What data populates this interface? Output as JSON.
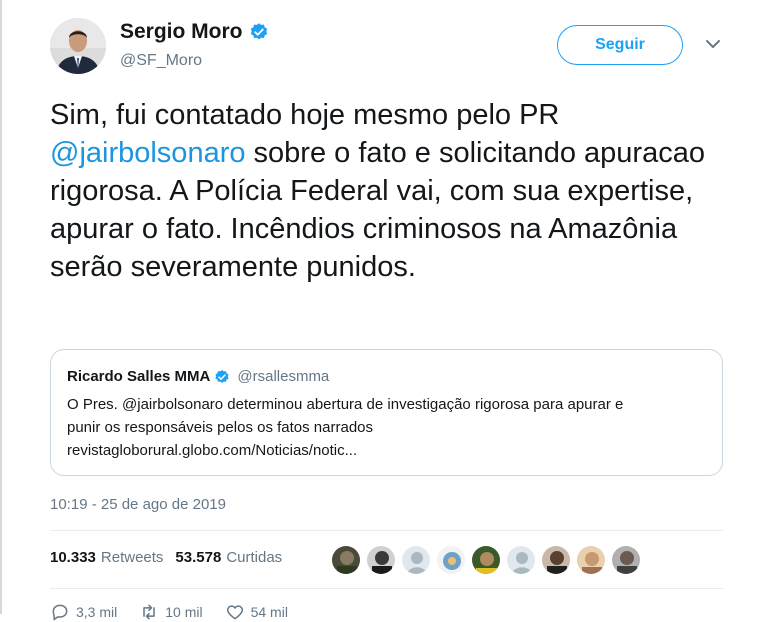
{
  "tweet": {
    "display_name": "Sergio Moro",
    "handle": "@SF_Moro",
    "follow_label": "Seguir",
    "text_part1": "Sim, fui contatado hoje mesmo pelo PR ",
    "mention": "@jairbolsonaro",
    "text_part2": " sobre o fato e solicitando apuracao rigorosa. A Polícia Federal vai, com sua expertise, apurar o fato. Incêndios criminosos na Amazônia serão severamente punidos.",
    "timestamp": "10:19 - 25 de ago de 2019"
  },
  "quoted": {
    "display_name": "Ricardo Salles MMA",
    "handle": "@rsallesmma",
    "line1": "O Pres. @jairbolsonaro determinou abertura de investigação rigorosa para apurar e",
    "line2": "punir os responsáveis pelos os fatos narrados",
    "line3": "revistagloborural.globo.com/Noticias/notic..."
  },
  "stats": {
    "retweets_count": "10.333",
    "retweets_label": "Retweets",
    "likes_count": "53.578",
    "likes_label": "Curtidas"
  },
  "actions": {
    "reply_count": "3,3 mil",
    "retweet_count": "10 mil",
    "like_count": "54 mil"
  },
  "colors": {
    "accent": "#1da1f2",
    "mention": "#1b95e0",
    "muted": "#657786",
    "border": "#ccd6dd"
  },
  "icons": [
    "verified-badge-icon",
    "chevron-down-icon",
    "reply-icon",
    "retweet-icon",
    "like-icon"
  ]
}
